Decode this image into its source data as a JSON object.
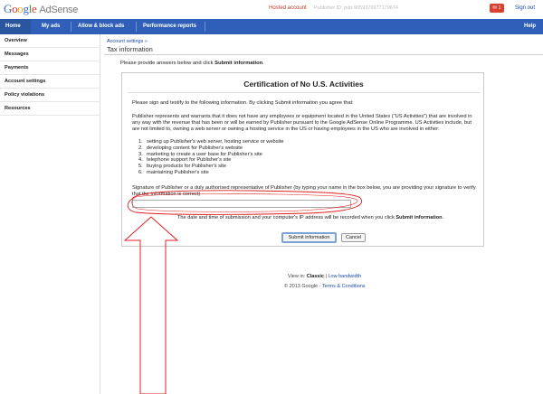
{
  "header": {
    "logo_google": [
      "G",
      "o",
      "o",
      "g",
      "l",
      "e"
    ],
    "logo_product": "AdSense",
    "hosted_account": "Hosted account",
    "publisher_id": "Publisher ID: pub-9059376977179674",
    "mail_count": "1",
    "sign_out": "Sign out"
  },
  "nav": {
    "home": "Home",
    "my_ads": "My ads",
    "allow_block": "Allow & block ads",
    "performance": "Performance reports",
    "help": "Help"
  },
  "sidebar": {
    "items": [
      {
        "label": "Overview"
      },
      {
        "label": "Messages"
      },
      {
        "label": "Payments"
      },
      {
        "label": "Account settings"
      },
      {
        "label": "Policy violations"
      },
      {
        "label": "Resources"
      }
    ]
  },
  "main": {
    "breadcrumb": "Account settings »",
    "title": "Tax information",
    "intro_prefix": "Please provide answers below and click ",
    "intro_bold": "Submit information",
    "intro_suffix": "."
  },
  "certification": {
    "heading": "Certification of No U.S. Activities",
    "para1": "Please sign and testify to the following information. By clicking Submit information you agree that:",
    "para2": "Publisher represents and warrants that it does not have any employees or equipment located in the United States (\"US Activities\") that are involved in any way with the revenue that has been or will be earned by Publisher pursuant to the Google AdSense Online Programme. US Activities include, but are not limited to, owning a web server or owning a hosting service in the US or having employees in the US who are involved in either:",
    "list": [
      {
        "num": "1.",
        "text": "setting up Publisher's web server, hosting service or website"
      },
      {
        "num": "2.",
        "text": "developing content for Publisher's website"
      },
      {
        "num": "3.",
        "text": "marketing to create a user base for Publisher's site"
      },
      {
        "num": "4.",
        "text": "telephone support for Publisher's site"
      },
      {
        "num": "5.",
        "text": "buying products for Publisher's site"
      },
      {
        "num": "6.",
        "text": "maintaining Publisher's site"
      }
    ],
    "signature_label": "Signature of Publisher or a duly authorised representative of Publisher (by typing your name in the box below, you are providing your signature to verify that the information is correct)",
    "signature_value": "",
    "record_prefix": "The date and time of submission and your computer's IP address will be recorded when you click ",
    "record_bold": "Submit information",
    "record_suffix": ".",
    "submit_label": "Submit information",
    "cancel_label": "Cancel"
  },
  "footer": {
    "view_in": "View in: ",
    "classic": "Classic",
    "separator": " | ",
    "low_bandwidth": "Low bandwidth",
    "copyright": "© 2013 Google - ",
    "terms": "Terms & Conditions"
  },
  "colors": {
    "nav_blue": "#2f5fb8",
    "annotation_red": "#e02020",
    "mail_badge": "#d9402f"
  }
}
